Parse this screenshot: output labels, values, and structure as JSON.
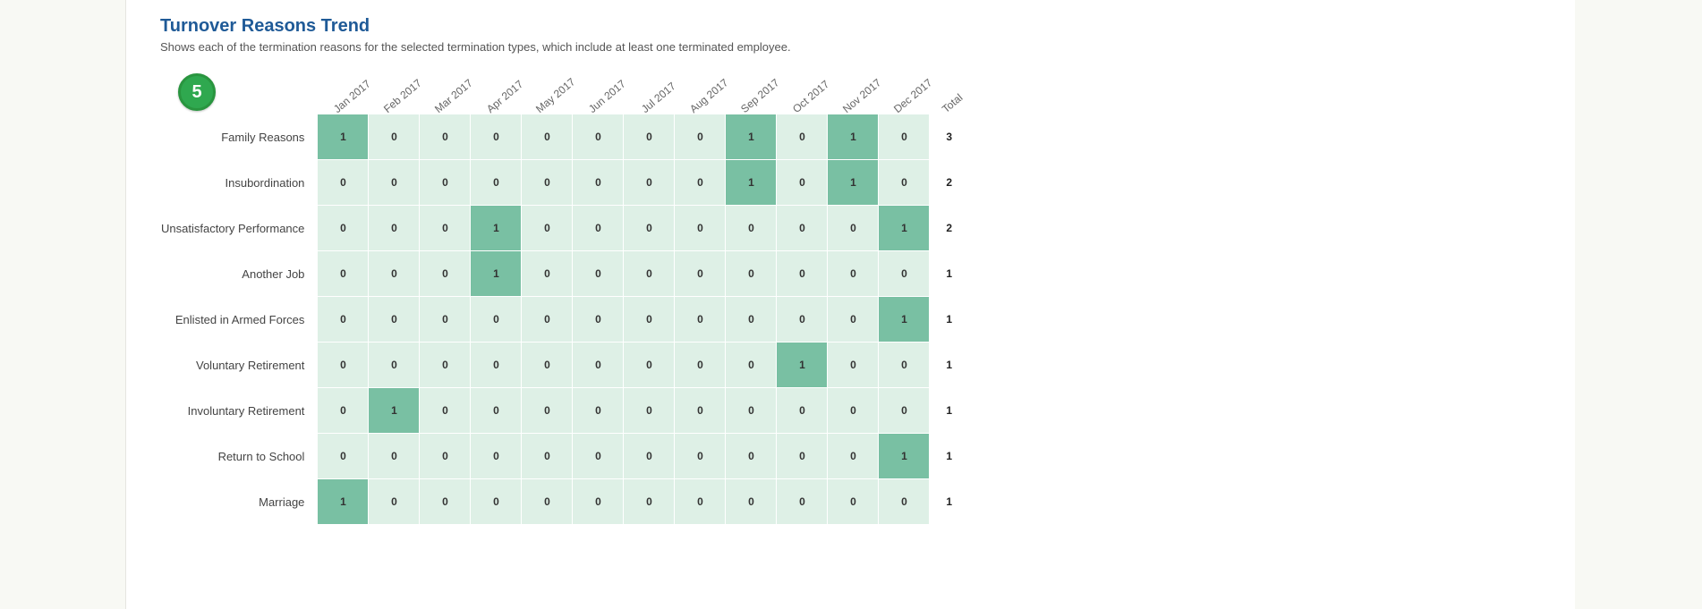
{
  "title": "Turnover Reasons Trend",
  "subtitle": "Shows each of the termination reasons for the selected termination types, which include at least one terminated employee.",
  "badge": "5",
  "total_label": "Total",
  "chart_data": {
    "type": "heatmap",
    "title": "Turnover Reasons Trend",
    "xlabel": "",
    "ylabel": "",
    "categories": [
      "Jan 2017",
      "Feb 2017",
      "Mar 2017",
      "Apr 2017",
      "May 2017",
      "Jun 2017",
      "Jul 2017",
      "Aug 2017",
      "Sep 2017",
      "Oct 2017",
      "Nov 2017",
      "Dec 2017"
    ],
    "rows": [
      "Family Reasons",
      "Insubordination",
      "Unsatisfactory Performance",
      "Another Job",
      "Enlisted in Armed Forces",
      "Voluntary Retirement",
      "Involuntary Retirement",
      "Return to School",
      "Marriage"
    ],
    "values": [
      [
        1,
        0,
        0,
        0,
        0,
        0,
        0,
        0,
        1,
        0,
        1,
        0
      ],
      [
        0,
        0,
        0,
        0,
        0,
        0,
        0,
        0,
        1,
        0,
        1,
        0
      ],
      [
        0,
        0,
        0,
        1,
        0,
        0,
        0,
        0,
        0,
        0,
        0,
        1
      ],
      [
        0,
        0,
        0,
        1,
        0,
        0,
        0,
        0,
        0,
        0,
        0,
        0
      ],
      [
        0,
        0,
        0,
        0,
        0,
        0,
        0,
        0,
        0,
        0,
        0,
        1
      ],
      [
        0,
        0,
        0,
        0,
        0,
        0,
        0,
        0,
        0,
        1,
        0,
        0
      ],
      [
        0,
        1,
        0,
        0,
        0,
        0,
        0,
        0,
        0,
        0,
        0,
        0
      ],
      [
        0,
        0,
        0,
        0,
        0,
        0,
        0,
        0,
        0,
        0,
        0,
        1
      ],
      [
        1,
        0,
        0,
        0,
        0,
        0,
        0,
        0,
        0,
        0,
        0,
        0
      ]
    ],
    "totals": [
      3,
      2,
      2,
      1,
      1,
      1,
      1,
      1,
      1
    ],
    "value_range": [
      0,
      1
    ]
  }
}
